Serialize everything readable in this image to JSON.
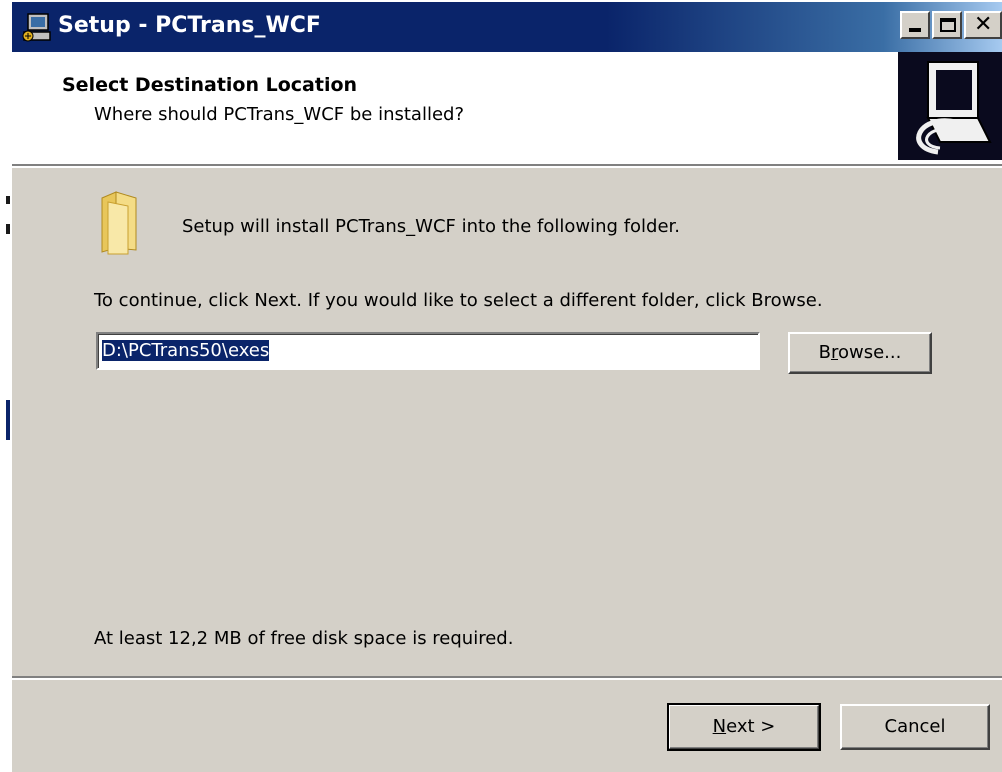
{
  "window": {
    "title": "Setup - PCTrans_WCF"
  },
  "header": {
    "title": "Select Destination Location",
    "subtitle": "Where should PCTrans_WCF be installed?"
  },
  "body": {
    "intro": "Setup will install PCTrans_WCF into the following folder.",
    "instruction": "To continue, click Next. If you would like to select a different folder, click Browse.",
    "path_value": "D:\\PCTrans50\\exes",
    "disk_space": "At least 12,2 MB of free disk space is required."
  },
  "buttons": {
    "browse": {
      "before": "B",
      "accel": "r",
      "after": "owse..."
    },
    "next": {
      "accel": "N",
      "after": "ext >"
    },
    "cancel": "Cancel"
  },
  "icons": {
    "title_icon": "setup-computer-icon",
    "header_logo": "setup-computer-logo-icon",
    "folder": "folder-icon"
  },
  "colors": {
    "titlebar": "#0a246a",
    "selection": "#0a246a",
    "face": "#d4d0c8"
  }
}
